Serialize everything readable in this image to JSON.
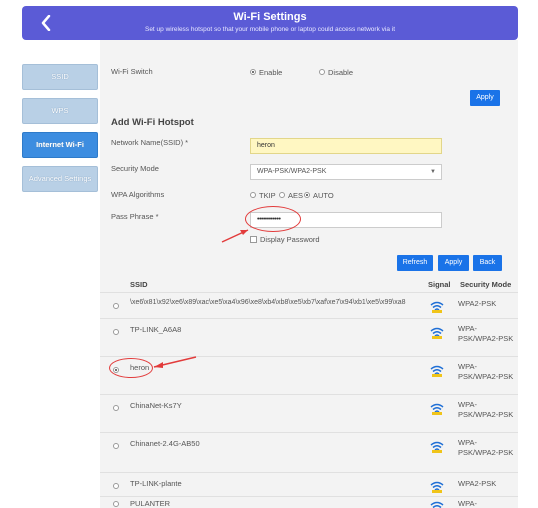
{
  "header": {
    "title": "Wi-Fi Settings",
    "subtitle": "Set up wireless hotspot so that your mobile phone or laptop could access network via it",
    "background_color": "#5b5bd6"
  },
  "sidebar": {
    "items": [
      {
        "label": "SSID",
        "active": false
      },
      {
        "label": "WPS",
        "active": false
      },
      {
        "label": "Internet Wi-Fi",
        "active": true
      },
      {
        "label": "Advanced Settings",
        "active": false
      }
    ]
  },
  "wifi_switch": {
    "label": "Wi-Fi Switch",
    "options": [
      "Enable",
      "Disable"
    ],
    "selected": "Enable"
  },
  "apply_top_label": "Apply",
  "hotspot": {
    "title": "Add Wi-Fi Hotspot",
    "ssid_label": "Network Name(SSID) *",
    "ssid_value": "heron",
    "security_label": "Security Mode",
    "security_value": "WPA-PSK/WPA2-PSK",
    "algo_label": "WPA Algorithms",
    "algo_options": [
      "TKIP",
      "AES",
      "AUTO"
    ],
    "algo_selected": "AUTO",
    "pass_label": "Pass Phrase *",
    "pass_value": "••••••••••••",
    "display_password_label": "Display Password"
  },
  "actions": {
    "refresh_label": "Refresh",
    "apply_label": "Apply",
    "back_label": "Back"
  },
  "table": {
    "headers": {
      "ssid": "SSID",
      "signal": "Signal",
      "security": "Security Mode"
    },
    "rows": [
      {
        "ssid": "\\xe6\\x81\\x92\\xe6\\x89\\xac\\xe5\\xa4\\x96\\xe8\\xb4\\xb8\\xe5\\xb7\\xaf\\xe7\\x94\\xb1\\xe5\\x99\\xa8",
        "security": "WPA2-PSK",
        "selected": false
      },
      {
        "ssid": "TP-LINK_A6A8",
        "security": "WPA-PSK/WPA2-PSK",
        "selected": false
      },
      {
        "ssid": "heron",
        "security": "WPA-PSK/WPA2-PSK",
        "selected": true
      },
      {
        "ssid": "ChinaNet-Ks7Y",
        "security": "WPA-PSK/WPA2-PSK",
        "selected": false
      },
      {
        "ssid": "Chinanet-2.4G-AB50",
        "security": "WPA-PSK/WPA2-PSK",
        "selected": false
      },
      {
        "ssid": "TP-LINK-plante",
        "security": "WPA2-PSK",
        "selected": false
      },
      {
        "ssid": "PULANTER",
        "security": "WPA-",
        "selected": false
      }
    ]
  },
  "colors": {
    "accent_blue": "#1a73e8",
    "sidebar_active": "#3d8de0",
    "sidebar_inactive": "#b9d0e6",
    "annotation_red": "#e23b3b",
    "ssid_field_bg": "#fff7c2"
  }
}
